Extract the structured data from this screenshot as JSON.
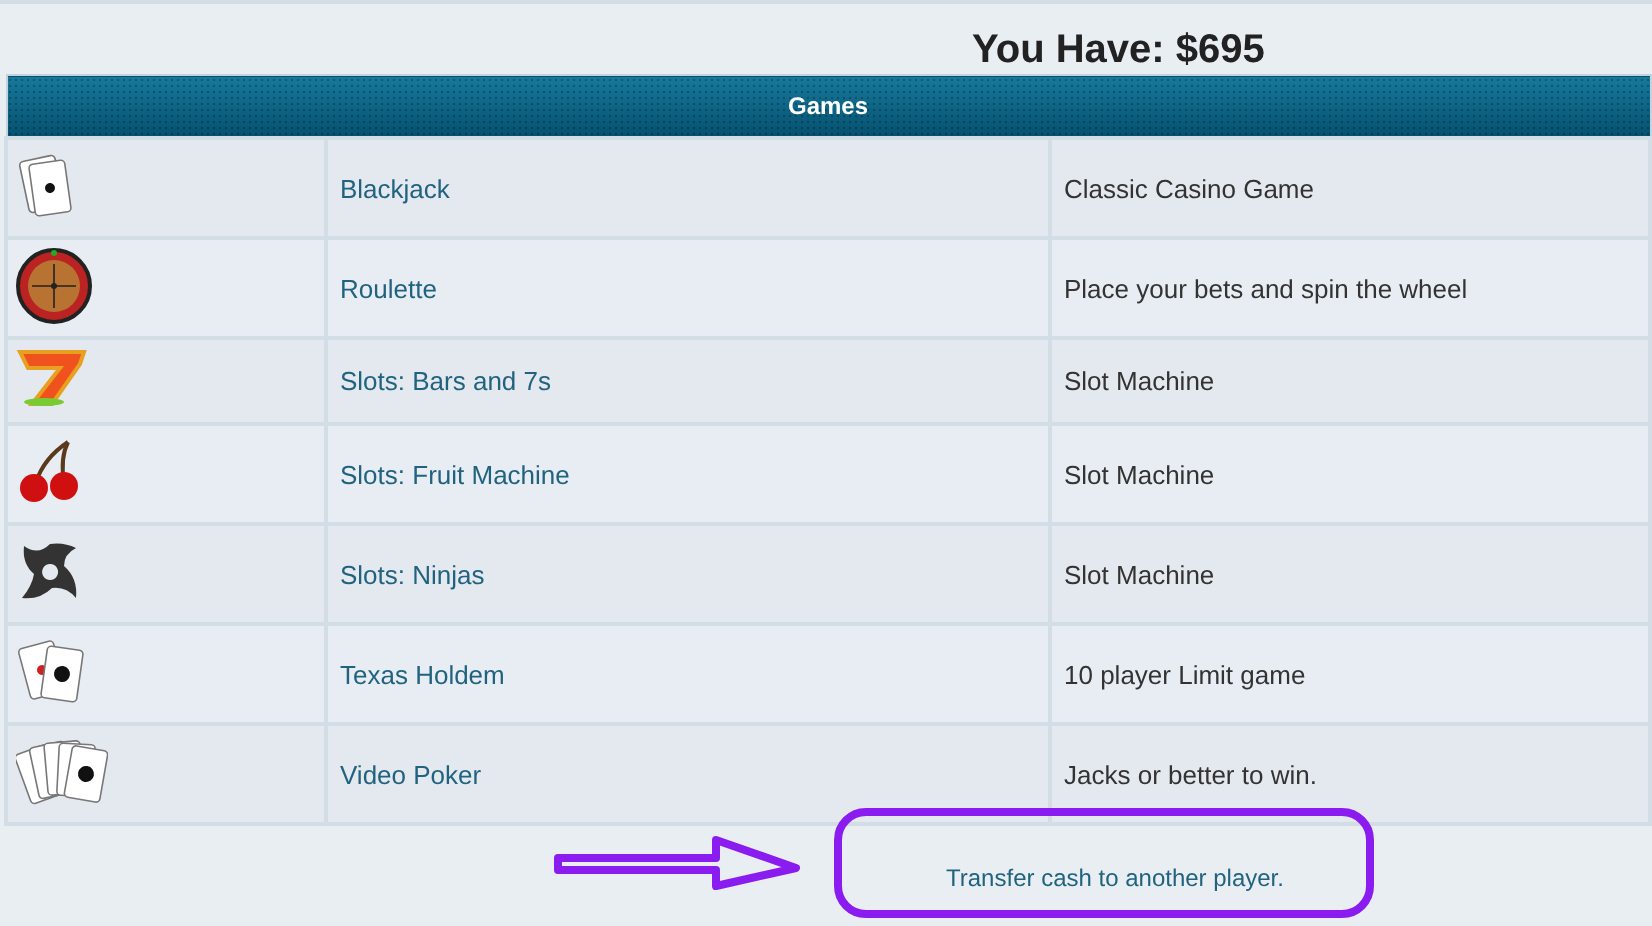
{
  "balance": "You Have: $695",
  "table": {
    "title": "Games",
    "rows": [
      {
        "name": "Blackjack",
        "description": "Classic Casino Game"
      },
      {
        "name": "Roulette",
        "description": "Place your bets and spin the wheel"
      },
      {
        "name": "Slots: Bars and 7s",
        "description": "Slot Machine"
      },
      {
        "name": "Slots: Fruit Machine",
        "description": "Slot Machine"
      },
      {
        "name": "Slots: Ninjas",
        "description": "Slot Machine"
      },
      {
        "name": "Texas Holdem",
        "description": "10 player Limit game"
      },
      {
        "name": "Video Poker",
        "description": "Jacks or better to win."
      }
    ]
  },
  "transfer_link": "Transfer cash to another player."
}
